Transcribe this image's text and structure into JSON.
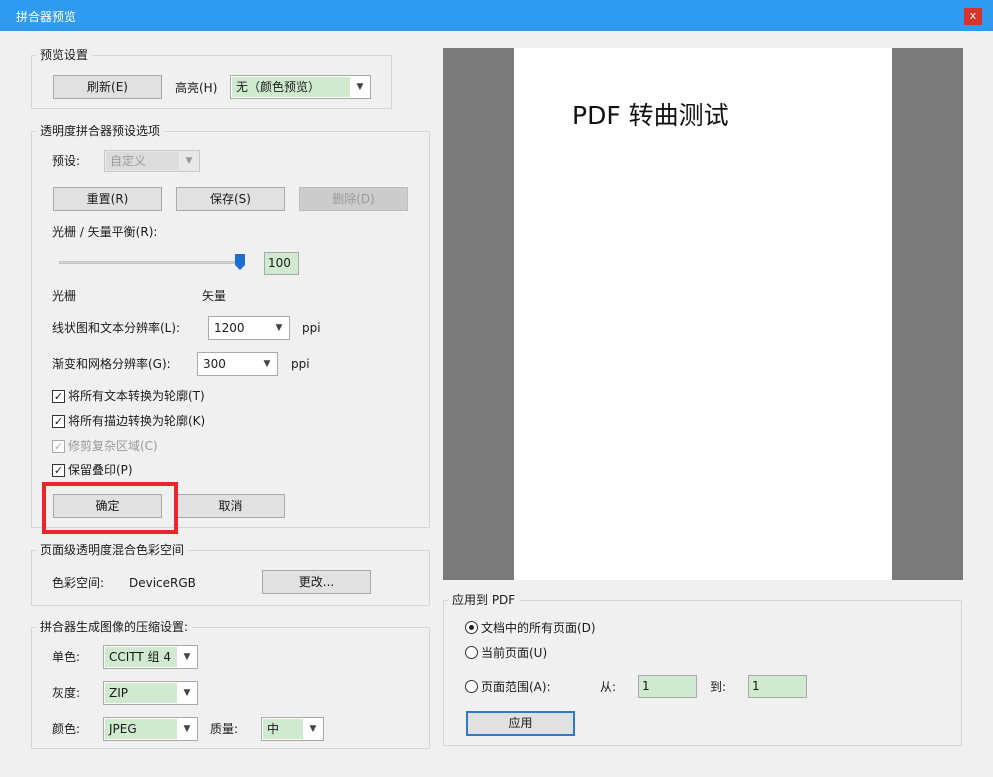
{
  "window": {
    "title": "拼合器预览",
    "close_label": "x"
  },
  "preview_settings": {
    "legend": "预览设置",
    "refresh_label": "刷新(E)",
    "highlight_label": "高亮(H)",
    "highlight_value": "无（颜色预览）"
  },
  "presets_group": {
    "legend": "透明度拼合器预设选项",
    "preset_label": "预设:",
    "preset_value": "自定义",
    "reset_label": "重置(R)",
    "save_label": "保存(S)",
    "delete_label": "删除(D)",
    "balance_label": "光栅 / 矢量平衡(R):",
    "balance_value": "100",
    "raster_label": "光栅",
    "vector_label": "矢量",
    "line_res_label": "线状图和文本分辨率(L):",
    "line_res_value": "1200",
    "line_res_unit": "ppi",
    "gradient_res_label": "渐变和网格分辨率(G):",
    "gradient_res_value": "300",
    "gradient_res_unit": "ppi",
    "checkboxes": [
      {
        "label": "将所有文本转换为轮廓(T)",
        "checked": true,
        "disabled": false
      },
      {
        "label": "将所有描边转换为轮廓(K)",
        "checked": true,
        "disabled": false
      },
      {
        "label": "修剪复杂区域(C)",
        "checked": true,
        "disabled": true
      },
      {
        "label": "保留叠印(P)",
        "checked": true,
        "disabled": false
      }
    ],
    "ok_label": "确定",
    "cancel_label": "取消"
  },
  "color_space": {
    "legend": "页面级透明度混合色彩空间",
    "label": "色彩空间:",
    "value": "DeviceRGB",
    "change_label": "更改..."
  },
  "compression": {
    "legend": "拼合器生成图像的压缩设置:",
    "mono_label": "单色:",
    "mono_value": "CCITT 组 4",
    "gray_label": "灰度:",
    "gray_value": "ZIP",
    "color_label": "颜色:",
    "color_value": "JPEG",
    "quality_label": "质量:",
    "quality_value": "中"
  },
  "preview": {
    "page_text": "PDF 转曲测试"
  },
  "apply_group": {
    "legend": "应用到 PDF",
    "radios": [
      {
        "label": "文档中的所有页面(D)",
        "selected": true
      },
      {
        "label": "当前页面(U)",
        "selected": false
      },
      {
        "label": "页面范围(A):",
        "selected": false
      }
    ],
    "from_label": "从:",
    "from_value": "1",
    "to_label": "到:",
    "to_value": "1",
    "apply_label": "应用"
  },
  "colors": {
    "titlebar": "#2f9bf0",
    "highlight": "#e8262b",
    "field_fill": "#cfeacf",
    "slider_thumb": "#1f6fd1"
  }
}
